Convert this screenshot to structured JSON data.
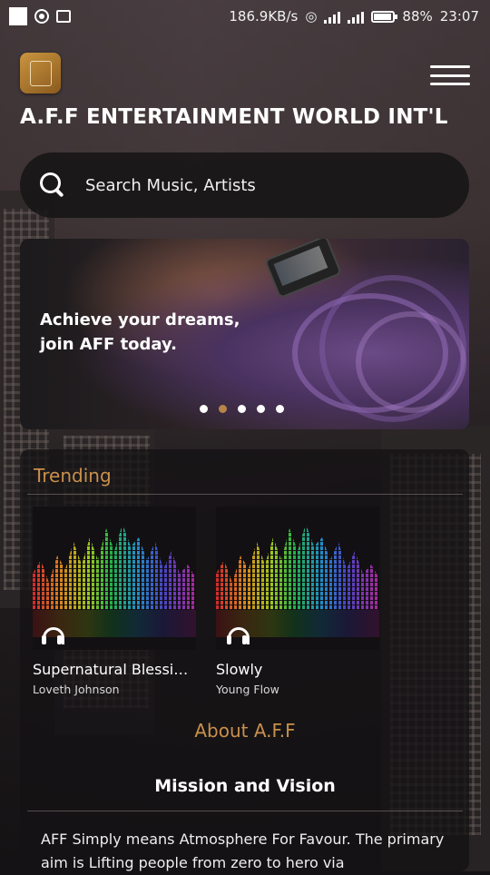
{
  "status_bar": {
    "speed": "186.9KB/s",
    "battery": "88%",
    "time": "23:07"
  },
  "header": {
    "title": "A.F.F ENTERTAINMENT WORLD INT'L"
  },
  "search": {
    "placeholder": "Search Music, Artists"
  },
  "banner": {
    "line1": "Achieve your dreams,",
    "line2": "join AFF today.",
    "slides": 5,
    "active_slide": 2
  },
  "trending": {
    "title": "Trending",
    "items": [
      {
        "title": "Supernatural Blessin...",
        "artist": "Loveth Johnson"
      },
      {
        "title": "Slowly",
        "artist": "Young Flow"
      }
    ]
  },
  "about": {
    "title": "About A.F.F",
    "subtitle": "Mission and Vision",
    "text": "AFF Simply means Atmosphere For Favour. The primary aim is Lifting people from zero to hero via"
  },
  "colors": {
    "accent": "#c9904c",
    "active_dot": "#b8844a"
  }
}
